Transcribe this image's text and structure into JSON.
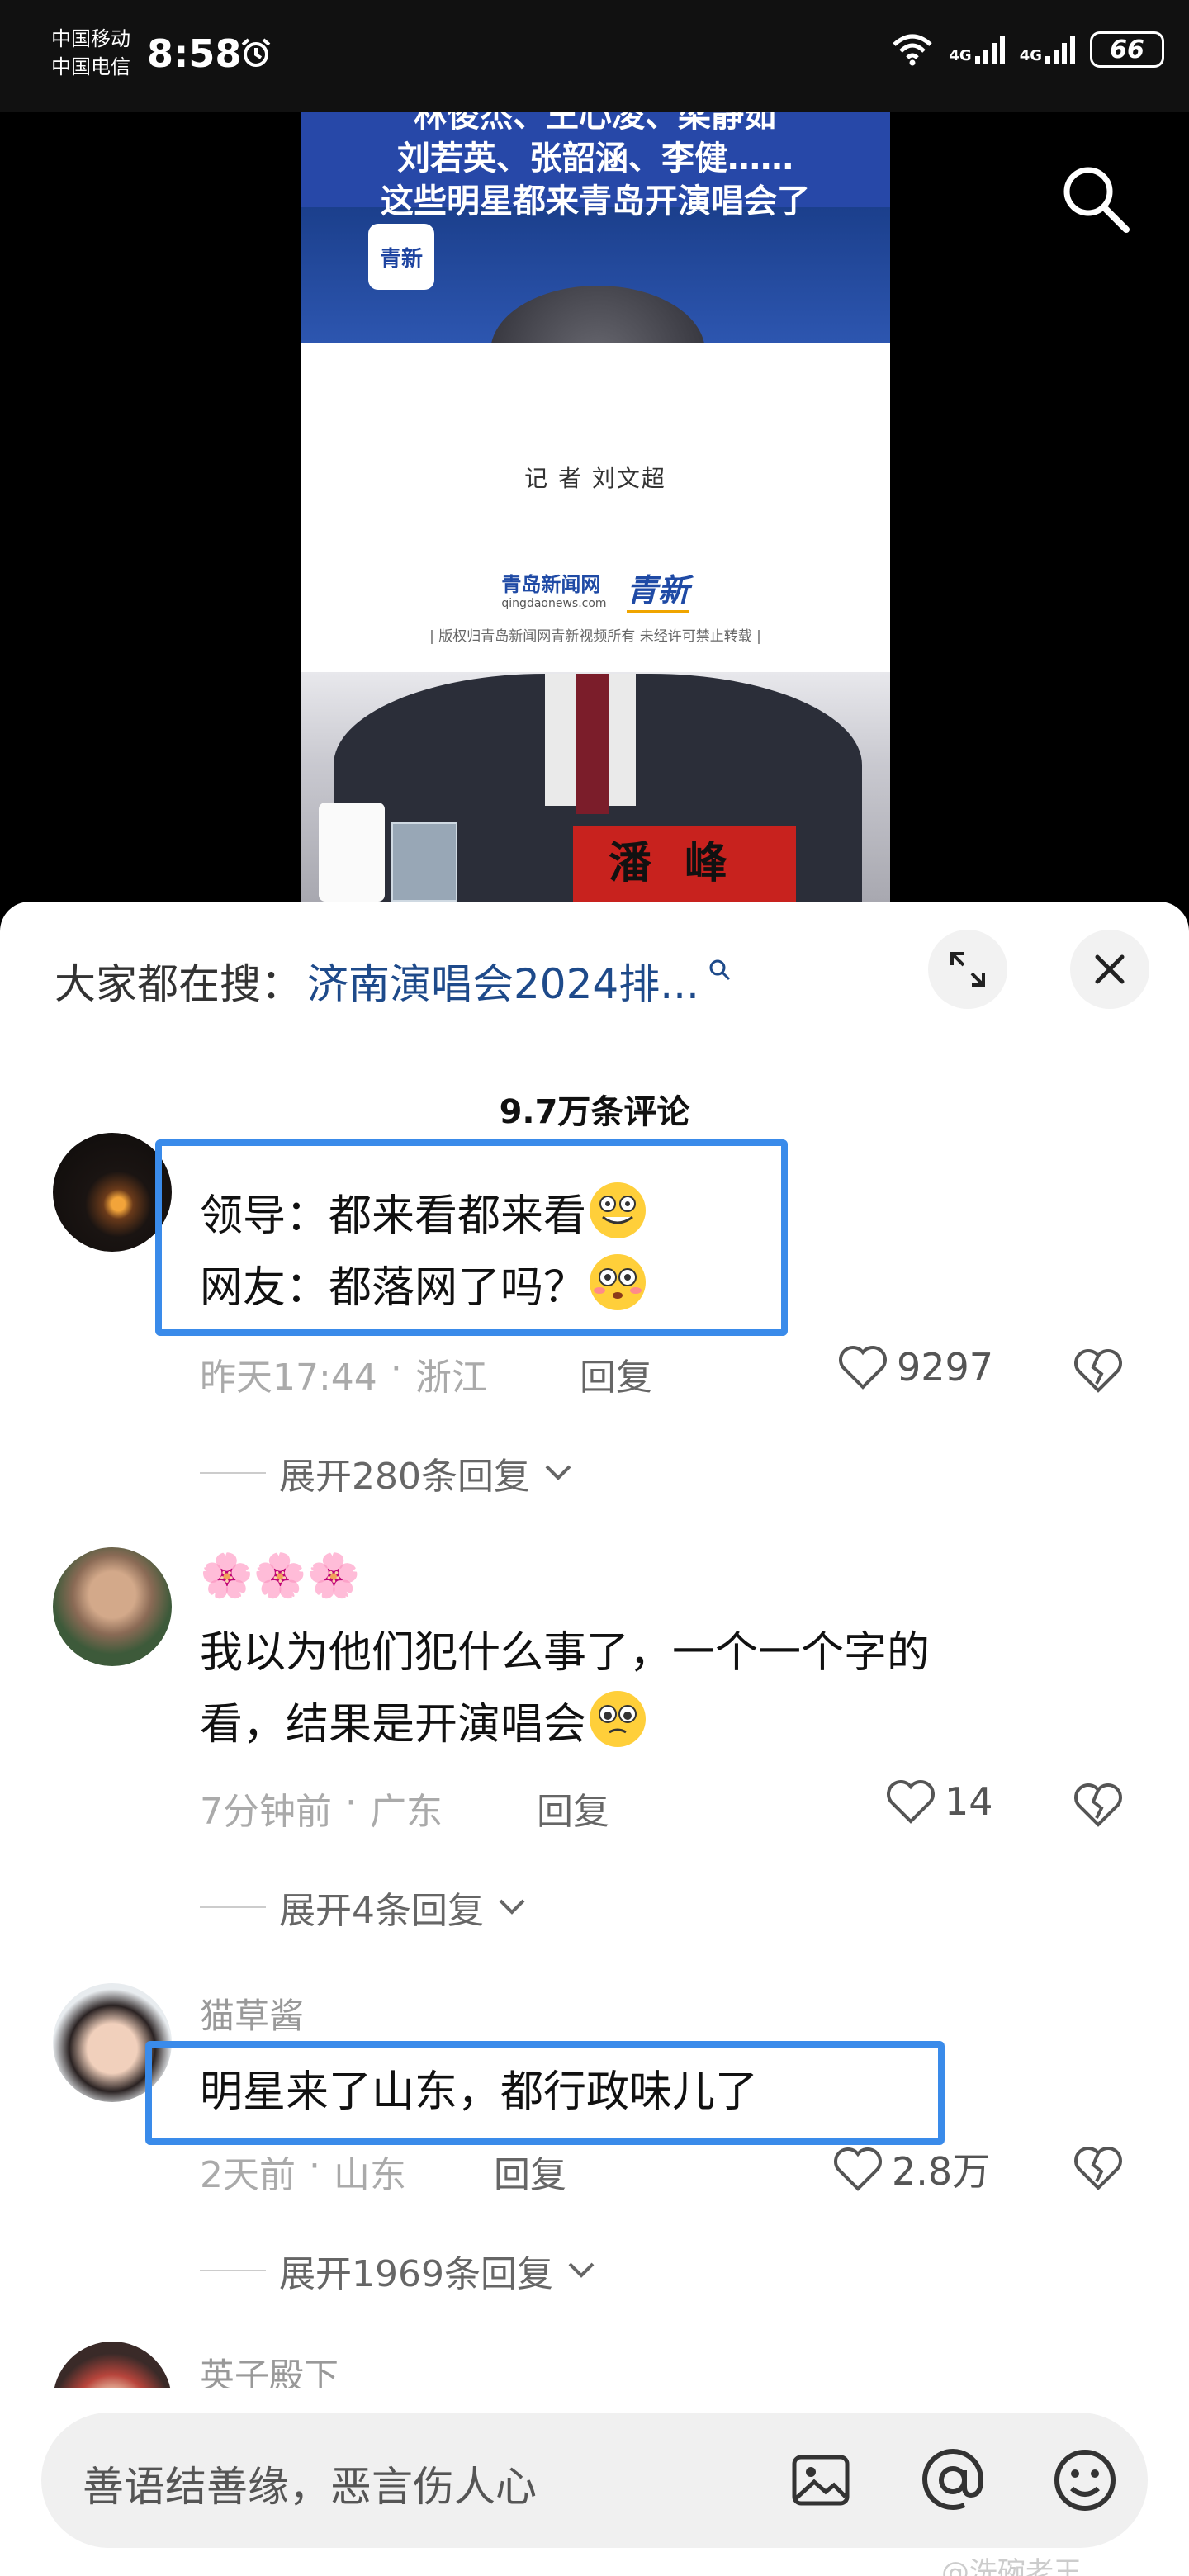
{
  "status_bar": {
    "carrier1": "中国移动",
    "carrier2": "中国电信",
    "time": "8:58",
    "net1": "4G",
    "net2": "4G",
    "battery": "66"
  },
  "video": {
    "banner_line1": "林俊杰、王心凌、梁静茹",
    "banner_line2": "刘若英、张韶涵、李健……",
    "banner_line3": "这些明星都来青岛开演唱会了",
    "logo": "青新",
    "reporter": "记 者    刘文超",
    "brand1": "青岛新闻网",
    "brand1_url": "qingdaonews.com",
    "brand2": "青新",
    "copyright": "| 版权归青岛新闻网青新视频所有 未经许可禁止转载 |",
    "nameplate": "潘峰"
  },
  "sheet": {
    "hot_search_label": "大家都在搜：",
    "hot_search_term": "济南演唱会2024排...",
    "comments_count": "9.7万条评论"
  },
  "comments": [
    {
      "username": "",
      "line1": "领导：都来看都来看",
      "line2": "网友：都落网了吗？",
      "time": "昨天17:44",
      "location": "浙江",
      "reply": "回复",
      "likes": "9297",
      "expand": "展开280条回复"
    },
    {
      "username": "🌸🌸🌸",
      "line1": "我以为他们犯什么事了，一个一个字的",
      "line2": "看，结果是开演唱会",
      "time": "7分钟前",
      "location": "广东",
      "reply": "回复",
      "likes": "14",
      "expand": "展开4条回复"
    },
    {
      "username": "猫草酱",
      "line1": "明星来了山东，都行政味儿了",
      "time": "2天前",
      "location": "山东",
      "reply": "回复",
      "likes": "2.8万",
      "expand": "展开1969条回复"
    },
    {
      "username": "英子殿下"
    }
  ],
  "input": {
    "placeholder": "善语结善缘，恶言伤人心",
    "watermark": "@洗碗老王"
  },
  "colors": {
    "highlight": "#3a8bea",
    "link": "#1e4a8a",
    "banner": "#2748a8"
  }
}
